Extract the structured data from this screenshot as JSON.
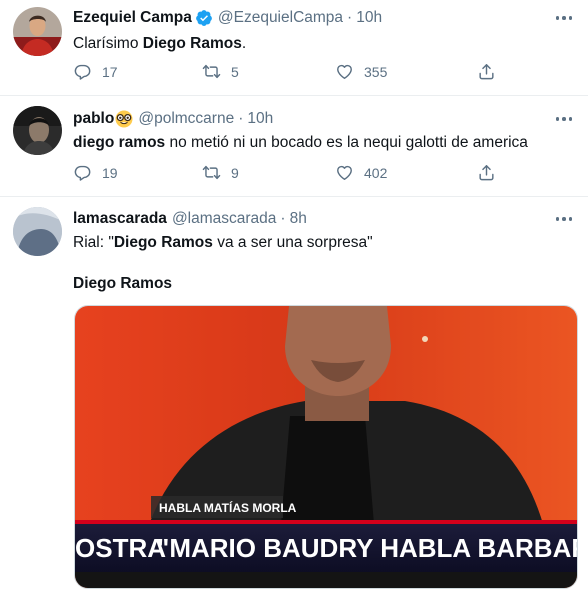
{
  "tweets": [
    {
      "name": "Ezequiel Campa",
      "verified": true,
      "handle": "@EzequielCampa",
      "separator": "·",
      "time": "10h",
      "text_parts": [
        "Clarísimo ",
        "Diego Ramos",
        "."
      ],
      "replies": "17",
      "retweets": "5",
      "likes": "355",
      "icons": [
        "reply-icon",
        "retweet-icon",
        "like-icon",
        "share-icon"
      ]
    },
    {
      "name": "pablo",
      "emoji": "nerd-face-emoji",
      "handle": "@polmccarne",
      "separator": "·",
      "time": "10h",
      "text_parts": [
        "diego ramos",
        " no metió ni un bocado es la nequi galotti de america"
      ],
      "replies": "19",
      "retweets": "9",
      "likes": "402"
    },
    {
      "name": "lamascarada",
      "handle": "@lamascarada",
      "separator": "·",
      "time": "8h",
      "text_parts": [
        "Rial: \"",
        "Diego Ramos",
        " va a ser una sorpresa\""
      ],
      "subtext": "Diego Ramos",
      "media": {
        "lower_third_small": "HABLA MATÍAS MORLA",
        "ticker_left": "OSTRA",
        "ticker_main": "\"MARIO BAUDRY HABLA BARBARIDADES DI"
      }
    }
  ],
  "colors": {
    "text": "#0f1419",
    "secondary": "#5b7083",
    "verified": "#1da1f2",
    "divider": "#ebeef0"
  }
}
